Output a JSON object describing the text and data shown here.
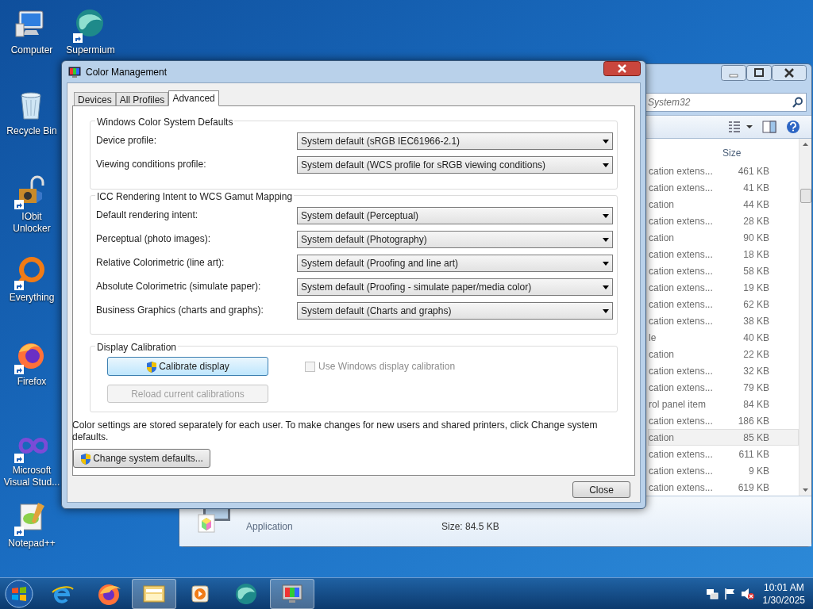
{
  "desktop_icons": [
    {
      "label": "Computer",
      "kind": "computer",
      "shortcut": false
    },
    {
      "label": "Supermium",
      "kind": "supermium",
      "shortcut": true
    },
    {
      "label": "Recycle Bin",
      "kind": "recycle",
      "shortcut": false
    },
    {
      "label": "IObit Unlocker",
      "kind": "unlocker",
      "shortcut": true
    },
    {
      "label": "Everything",
      "kind": "everything",
      "shortcut": true
    },
    {
      "label": "Firefox",
      "kind": "firefox",
      "shortcut": true
    },
    {
      "label": "Microsoft Visual Stud...",
      "kind": "vs",
      "shortcut": true
    },
    {
      "label": "Notepad++",
      "kind": "notepad",
      "shortcut": true
    }
  ],
  "explorer": {
    "search_placeholder": "System32",
    "column": "Size",
    "rows": [
      {
        "type": "cation extens...",
        "size": "461 KB",
        "selected": false
      },
      {
        "type": "cation extens...",
        "size": "41 KB",
        "selected": false
      },
      {
        "type": "cation",
        "size": "44 KB",
        "selected": false
      },
      {
        "type": "cation extens...",
        "size": "28 KB",
        "selected": false
      },
      {
        "type": "cation",
        "size": "90 KB",
        "selected": false
      },
      {
        "type": "cation extens...",
        "size": "18 KB",
        "selected": false
      },
      {
        "type": "cation extens...",
        "size": "58 KB",
        "selected": false
      },
      {
        "type": "cation extens...",
        "size": "19 KB",
        "selected": false
      },
      {
        "type": "cation extens...",
        "size": "62 KB",
        "selected": false
      },
      {
        "type": "cation extens...",
        "size": "38 KB",
        "selected": false
      },
      {
        "type": "le",
        "size": "40 KB",
        "selected": false
      },
      {
        "type": "cation",
        "size": "22 KB",
        "selected": false
      },
      {
        "type": "cation extens...",
        "size": "32 KB",
        "selected": false
      },
      {
        "type": "cation extens...",
        "size": "79 KB",
        "selected": false
      },
      {
        "type": "rol panel item",
        "size": "84 KB",
        "selected": false
      },
      {
        "type": "cation extens...",
        "size": "186 KB",
        "selected": false
      },
      {
        "type": "cation",
        "size": "85 KB",
        "selected": true
      },
      {
        "type": "cation extens...",
        "size": "611 KB",
        "selected": false
      },
      {
        "type": "cation extens...",
        "size": "9 KB",
        "selected": false
      },
      {
        "type": "cation extens...",
        "size": "619 KB",
        "selected": false
      }
    ],
    "details": {
      "type": "Application",
      "size": "Size: 84.5 KB"
    }
  },
  "dialog": {
    "title": "Color Management",
    "tabs": [
      {
        "label": "Devices",
        "selected": false
      },
      {
        "label": "All Profiles",
        "selected": false
      },
      {
        "label": "Advanced",
        "selected": true
      }
    ],
    "groups": [
      {
        "title": "Windows Color System Defaults",
        "rows": [
          {
            "label": "Device profile:",
            "value": "System default (sRGB IEC61966-2.1)"
          },
          {
            "label": "Viewing conditions profile:",
            "value": "System default (WCS profile for sRGB viewing conditions)"
          }
        ]
      },
      {
        "title": "ICC Rendering Intent to WCS Gamut Mapping",
        "rows": [
          {
            "label": "Default rendering intent:",
            "value": "System default (Perceptual)"
          },
          {
            "label": "Perceptual (photo images):",
            "value": "System default (Photography)"
          },
          {
            "label": "Relative Colorimetric (line art):",
            "value": "System default (Proofing and line art)"
          },
          {
            "label": "Absolute Colorimetric (simulate paper):",
            "value": "System default (Proofing - simulate paper/media color)"
          },
          {
            "label": "Business Graphics (charts and graphs):",
            "value": "System default (Charts and graphs)"
          }
        ]
      }
    ],
    "calibration": {
      "title": "Display Calibration",
      "calibrate_button": "Calibrate display",
      "reload_button": {
        "label": "Reload current calibrations",
        "disabled": true
      },
      "checkbox": {
        "label": "Use Windows display calibration",
        "checked": false,
        "disabled": true
      }
    },
    "note": "Color settings are stored separately for each user. To make changes for new users and shared printers, click Change system defaults.",
    "change_defaults_button": "Change system defaults...",
    "close_button": "Close"
  },
  "taskbar": {
    "apps": [
      {
        "kind": "ie",
        "active": false
      },
      {
        "kind": "firefox",
        "active": false
      },
      {
        "kind": "explorer",
        "active": true
      },
      {
        "kind": "media",
        "active": false
      },
      {
        "kind": "supermium",
        "active": false
      },
      {
        "kind": "colormgmt",
        "active": true
      }
    ],
    "time": "10:01 AM",
    "date": "1/30/2025"
  }
}
